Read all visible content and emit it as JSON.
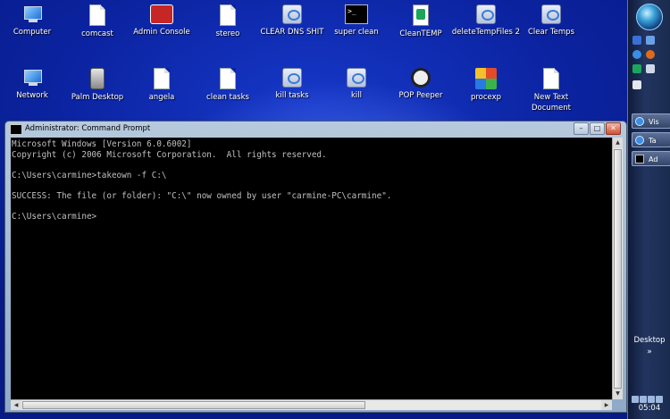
{
  "desktop": {
    "icons": [
      {
        "label": "Computer",
        "icon": "computer-icon"
      },
      {
        "label": "comcast",
        "icon": "document-icon"
      },
      {
        "label": "Admin Console",
        "icon": "admin-console-icon"
      },
      {
        "label": "stereo",
        "icon": "document-icon"
      },
      {
        "label": "CLEAR DNS SHIT",
        "icon": "batch-file-icon"
      },
      {
        "label": "super clean",
        "icon": "command-prompt-icon"
      },
      {
        "label": "CleanTEMP",
        "icon": "cleantemp-icon"
      },
      {
        "label": "deleteTempFiles 2",
        "icon": "batch-file-icon"
      },
      {
        "label": "Clear Temps",
        "icon": "batch-file-icon"
      },
      {
        "label": "Network",
        "icon": "network-icon"
      },
      {
        "label": "Palm Desktop",
        "icon": "palm-desktop-icon"
      },
      {
        "label": "angela",
        "icon": "document-icon"
      },
      {
        "label": "clean tasks",
        "icon": "document-icon"
      },
      {
        "label": "kill tasks",
        "icon": "batch-file-icon"
      },
      {
        "label": "kill",
        "icon": "batch-file-icon"
      },
      {
        "label": "POP Peeper",
        "icon": "pop-peeper-icon"
      },
      {
        "label": "procexp",
        "icon": "procexp-icon"
      },
      {
        "label": "New Text Document",
        "icon": "document-icon"
      }
    ]
  },
  "window": {
    "title": "Administrator: Command Prompt",
    "controls": {
      "minimize": "–",
      "maximize": "□",
      "close": "✕"
    },
    "console_lines": [
      "Microsoft Windows [Version 6.0.6002]",
      "Copyright (c) 2006 Microsoft Corporation.  All rights reserved.",
      "",
      "C:\\Users\\carmine>takeown -f C:\\",
      "",
      "SUCCESS: The file (or folder): \"C:\\\" now owned by user \"carmine-PC\\carmine\".",
      "",
      "C:\\Users\\carmine>"
    ]
  },
  "sidebar": {
    "taskbar_buttons": [
      {
        "label": "Vis",
        "icon": "internet-explorer-icon"
      },
      {
        "label": "Ta",
        "icon": "internet-explorer-icon"
      },
      {
        "label": "Ad",
        "icon": "command-prompt-icon"
      }
    ],
    "desktop_label": "Desktop",
    "chevron": "»",
    "clock": "05:04"
  }
}
